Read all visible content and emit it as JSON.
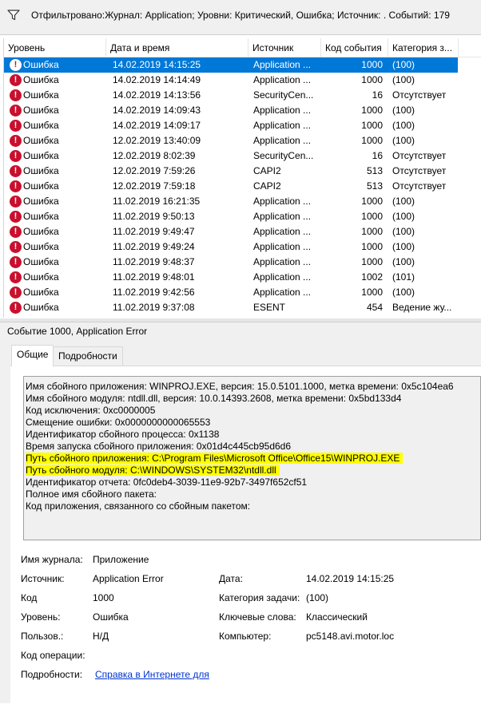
{
  "filter": {
    "text": "Отфильтровано:Журнал: Application; Уровни: Критический, Ошибка; Источник: . Событий: 179"
  },
  "columns": [
    "Уровень",
    "Дата и время",
    "Источник",
    "Код события",
    "Категория з..."
  ],
  "events": [
    {
      "level": "Ошибка",
      "datetime": "14.02.2019 14:15:25",
      "source": "Application ...",
      "code": "1000",
      "category": "(100)",
      "selected": true
    },
    {
      "level": "Ошибка",
      "datetime": "14.02.2019 14:14:49",
      "source": "Application ...",
      "code": "1000",
      "category": "(100)"
    },
    {
      "level": "Ошибка",
      "datetime": "14.02.2019 14:13:56",
      "source": "SecurityCen...",
      "code": "16",
      "category": "Отсутствует"
    },
    {
      "level": "Ошибка",
      "datetime": "14.02.2019 14:09:43",
      "source": "Application ...",
      "code": "1000",
      "category": "(100)"
    },
    {
      "level": "Ошибка",
      "datetime": "14.02.2019 14:09:17",
      "source": "Application ...",
      "code": "1000",
      "category": "(100)"
    },
    {
      "level": "Ошибка",
      "datetime": "12.02.2019 13:40:09",
      "source": "Application ...",
      "code": "1000",
      "category": "(100)"
    },
    {
      "level": "Ошибка",
      "datetime": "12.02.2019 8:02:39",
      "source": "SecurityCen...",
      "code": "16",
      "category": "Отсутствует"
    },
    {
      "level": "Ошибка",
      "datetime": "12.02.2019 7:59:26",
      "source": "CAPI2",
      "code": "513",
      "category": "Отсутствует"
    },
    {
      "level": "Ошибка",
      "datetime": "12.02.2019 7:59:18",
      "source": "CAPI2",
      "code": "513",
      "category": "Отсутствует"
    },
    {
      "level": "Ошибка",
      "datetime": "11.02.2019 16:21:35",
      "source": "Application ...",
      "code": "1000",
      "category": "(100)"
    },
    {
      "level": "Ошибка",
      "datetime": "11.02.2019 9:50:13",
      "source": "Application ...",
      "code": "1000",
      "category": "(100)"
    },
    {
      "level": "Ошибка",
      "datetime": "11.02.2019 9:49:47",
      "source": "Application ...",
      "code": "1000",
      "category": "(100)"
    },
    {
      "level": "Ошибка",
      "datetime": "11.02.2019 9:49:24",
      "source": "Application ...",
      "code": "1000",
      "category": "(100)"
    },
    {
      "level": "Ошибка",
      "datetime": "11.02.2019 9:48:37",
      "source": "Application ...",
      "code": "1000",
      "category": "(100)"
    },
    {
      "level": "Ошибка",
      "datetime": "11.02.2019 9:48:01",
      "source": "Application ...",
      "code": "1002",
      "category": "(101)"
    },
    {
      "level": "Ошибка",
      "datetime": "11.02.2019 9:42:56",
      "source": "Application ...",
      "code": "1000",
      "category": "(100)"
    },
    {
      "level": "Ошибка",
      "datetime": "11.02.2019 9:37:08",
      "source": "ESENT",
      "code": "454",
      "category": "Ведение жу..."
    }
  ],
  "detail": {
    "title": "Событие 1000, Application Error",
    "tabs": [
      "Общие",
      "Подробности"
    ],
    "description_lines": [
      {
        "text": "Имя сбойного приложения: WINPROJ.EXE, версия: 15.0.5101.1000, метка времени: 0x5c104ea6",
        "highlight": false
      },
      {
        "text": "Имя сбойного модуля: ntdll.dll, версия: 10.0.14393.2608, метка времени: 0x5bd133d4",
        "highlight": false
      },
      {
        "text": "Код исключения: 0xc0000005",
        "highlight": false
      },
      {
        "text": "Смещение ошибки: 0x0000000000065553",
        "highlight": false
      },
      {
        "text": "Идентификатор сбойного процесса: 0x1138",
        "highlight": false
      },
      {
        "text": "Время запуска сбойного приложения: 0x01d4c445cb95d6d6",
        "highlight": false
      },
      {
        "text": "Путь сбойного приложения: C:\\Program Files\\Microsoft Office\\Office15\\WINPROJ.EXE",
        "highlight": true
      },
      {
        "text": "Путь сбойного модуля: C:\\WINDOWS\\SYSTEM32\\ntdll.dll",
        "highlight": true
      },
      {
        "text": "Идентификатор отчета: 0fc0deb4-3039-11e9-92b7-3497f652cf51",
        "highlight": false
      },
      {
        "text": "Полное имя сбойного пакета:",
        "highlight": false
      },
      {
        "text": "Код приложения, связанного со сбойным пакетом:",
        "highlight": false
      }
    ],
    "props": {
      "log_label": "Имя журнала:",
      "log_value": "Приложение",
      "source_label": "Источник:",
      "source_value": "Application Error",
      "date_label": "Дата:",
      "date_value": "14.02.2019 14:15:25",
      "code_label": "Код",
      "code_value": "1000",
      "task_label": "Категория задачи:",
      "task_value": "(100)",
      "level_label": "Уровень:",
      "level_value": "Ошибка",
      "keywords_label": "Ключевые слова:",
      "keywords_value": "Классический",
      "user_label": "Пользов.:",
      "user_value": "Н/Д",
      "computer_label": "Компьютер:",
      "computer_value": "pc5148.avi.motor.loc",
      "opcode_label": "Код операции:",
      "more_label": "Подробности:",
      "more_link": "Справка в Интернете для"
    }
  },
  "colors": {
    "selection": "#0078d7",
    "error": "#c8102e",
    "highlight": "#ffff00",
    "link": "#0033cc"
  }
}
